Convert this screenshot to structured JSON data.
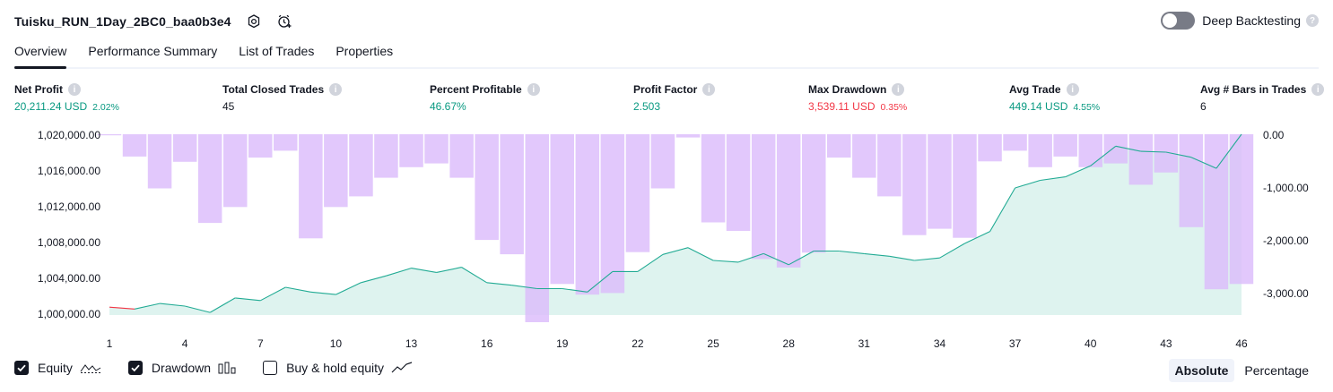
{
  "header": {
    "title": "Tuisku_RUN_1Day_2BC0_baa0b3e4",
    "deep_backtesting_label": "Deep Backtesting"
  },
  "tabs": [
    "Overview",
    "Performance Summary",
    "List of Trades",
    "Properties"
  ],
  "metrics": [
    {
      "label": "Net Profit",
      "value": "20,211.24 USD",
      "pct": "2.02%",
      "color": "green"
    },
    {
      "label": "Total Closed Trades",
      "value": "45",
      "pct": "",
      "color": "dark"
    },
    {
      "label": "Percent Profitable",
      "value": "46.67%",
      "pct": "",
      "color": "green"
    },
    {
      "label": "Profit Factor",
      "value": "2.503",
      "pct": "",
      "color": "green"
    },
    {
      "label": "Max Drawdown",
      "value": "3,539.11 USD",
      "pct": "0.35%",
      "color": "red"
    },
    {
      "label": "Avg Trade",
      "value": "449.14 USD",
      "pct": "4.55%",
      "color": "green"
    },
    {
      "label": "Avg # Bars in Trades",
      "value": "6",
      "pct": "",
      "color": "dark"
    }
  ],
  "legend": {
    "equity": "Equity",
    "drawdown": "Drawdown",
    "buy_hold": "Buy & hold equity"
  },
  "modes": {
    "absolute": "Absolute",
    "percentage": "Percentage"
  },
  "colors": {
    "equity_line": "#22ab94",
    "equity_fill": "#d8f1ec",
    "equity_negative": "#f23645",
    "drawdown_bar": "#dcbcfb",
    "profit": "#089981",
    "loss": "#f23645"
  },
  "chart_data": {
    "type": "line+bar",
    "x_ticks": [
      1,
      4,
      7,
      10,
      13,
      16,
      19,
      22,
      25,
      28,
      31,
      34,
      37,
      40,
      43,
      46
    ],
    "left_axis": {
      "ticks": [
        "1,020,000.00",
        "1,016,000.00",
        "1,012,000.00",
        "1,008,000.00",
        "1,004,000.00",
        "1,000,000.00"
      ],
      "ylim": [
        999000,
        1020200
      ]
    },
    "right_axis": {
      "ticks": [
        "0.00",
        "-1,000.00",
        "-2,000.00",
        "-3,000.00"
      ],
      "ylim": [
        -3540,
        0
      ]
    },
    "series": [
      {
        "name": "Equity",
        "x": [
          1,
          2,
          3,
          4,
          5,
          6,
          7,
          8,
          9,
          10,
          11,
          12,
          13,
          14,
          15,
          16,
          17,
          18,
          19,
          20,
          21,
          22,
          23,
          24,
          25,
          26,
          27,
          28,
          29,
          30,
          31,
          32,
          33,
          34,
          35,
          36,
          37,
          38,
          39,
          40,
          41,
          42,
          43,
          44,
          45,
          46
        ],
        "values": [
          999920,
          999700,
          1000350,
          1000050,
          999300,
          1001000,
          1000700,
          1002250,
          1001700,
          1001400,
          1002800,
          1003600,
          1004500,
          1004000,
          1004600,
          1002800,
          1002500,
          1002100,
          1002100,
          1001700,
          1004100,
          1004100,
          1006100,
          1006900,
          1005400,
          1005200,
          1006200,
          1004900,
          1006500,
          1006500,
          1006200,
          1005900,
          1005400,
          1005700,
          1007400,
          1008800,
          1013900,
          1014800,
          1015200,
          1016500,
          1018800,
          1018200,
          1018100,
          1017500,
          1016200,
          1020200
        ]
      },
      {
        "name": "Drawdown",
        "x": [
          1,
          2,
          3,
          4,
          5,
          6,
          7,
          8,
          9,
          10,
          11,
          12,
          13,
          14,
          15,
          16,
          17,
          18,
          19,
          20,
          21,
          22,
          23,
          24,
          25,
          26,
          27,
          28,
          29,
          30,
          31,
          32,
          33,
          34,
          35,
          36,
          37,
          38,
          39,
          40,
          41,
          42,
          43,
          44,
          45,
          46
        ],
        "values": [
          -20,
          -420,
          -1020,
          -520,
          -1670,
          -1370,
          -440,
          -310,
          -1960,
          -1370,
          -1170,
          -820,
          -620,
          -550,
          -820,
          -1990,
          -2260,
          -3540,
          -2820,
          -3020,
          -2990,
          -2220,
          -1020,
          -60,
          -1660,
          -1820,
          -2350,
          -2510,
          -2230,
          -440,
          -820,
          -1170,
          -1900,
          -1780,
          -1950,
          -510,
          -310,
          -620,
          -420,
          -620,
          -550,
          -950,
          -720,
          -1750,
          -2920,
          -2820
        ]
      }
    ]
  }
}
